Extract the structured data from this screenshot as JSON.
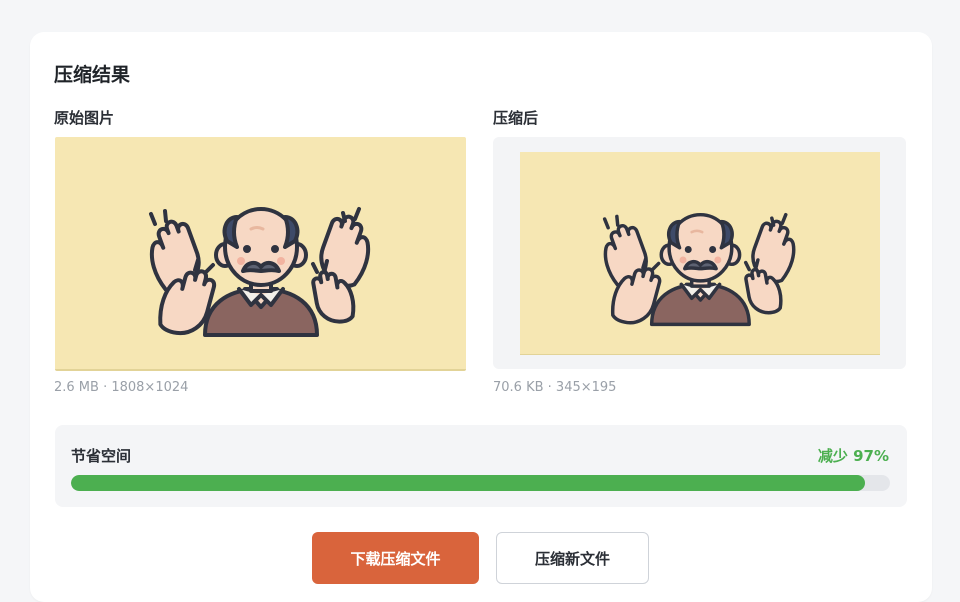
{
  "title": "压缩结果",
  "original": {
    "label": "原始图片",
    "meta": "2.6 MB · 1808×1024"
  },
  "compressed": {
    "label": "压缩后",
    "meta": "70.6 KB · 345×195"
  },
  "savings": {
    "label": "节省空间",
    "percent_label": "减少 97%",
    "fraction": 0.97
  },
  "actions": {
    "download_label": "下载压缩文件",
    "new_label": "压缩新文件"
  },
  "colors": {
    "accent": "#d9643c",
    "success": "#4caf50",
    "image_bg": "#f6e7b3"
  }
}
